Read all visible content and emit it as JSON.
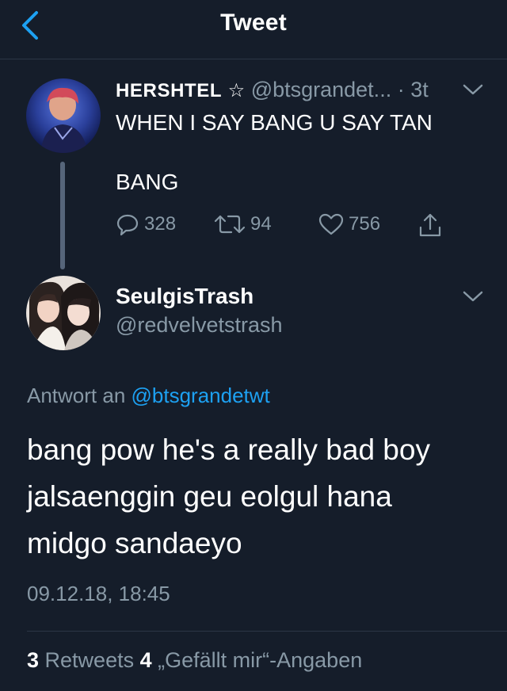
{
  "header": {
    "title": "Tweet"
  },
  "parent_tweet": {
    "name": "HERSHTEL",
    "star": "☆",
    "handle": "@btsgrandet...",
    "separator": " · ",
    "age": "3t",
    "text_line1": "WHEN I SAY BANG U SAY TAN",
    "text_line2": "BANG",
    "replies": "328",
    "retweets": "94",
    "likes": "756"
  },
  "tweet": {
    "name": "SeulgisTrash",
    "handle": "@redvelvetstrash",
    "reply_prefix": "Antwort an ",
    "reply_handle": "@btsgrandetwt",
    "lines": [
      "bang pow he's a really bad boy",
      "jalsaenggin geu eolgul hana",
      "midgo sandaeyo"
    ],
    "timestamp": "09.12.18, 18:45",
    "retweet_count": "3",
    "retweet_label": " Retweets ",
    "like_count": "4",
    "like_label": " „Gefällt mir“-Angaben"
  },
  "colors": {
    "background": "#151d2a",
    "muted": "#8899a6",
    "link": "#1da1f2",
    "divider": "#2b3646"
  }
}
